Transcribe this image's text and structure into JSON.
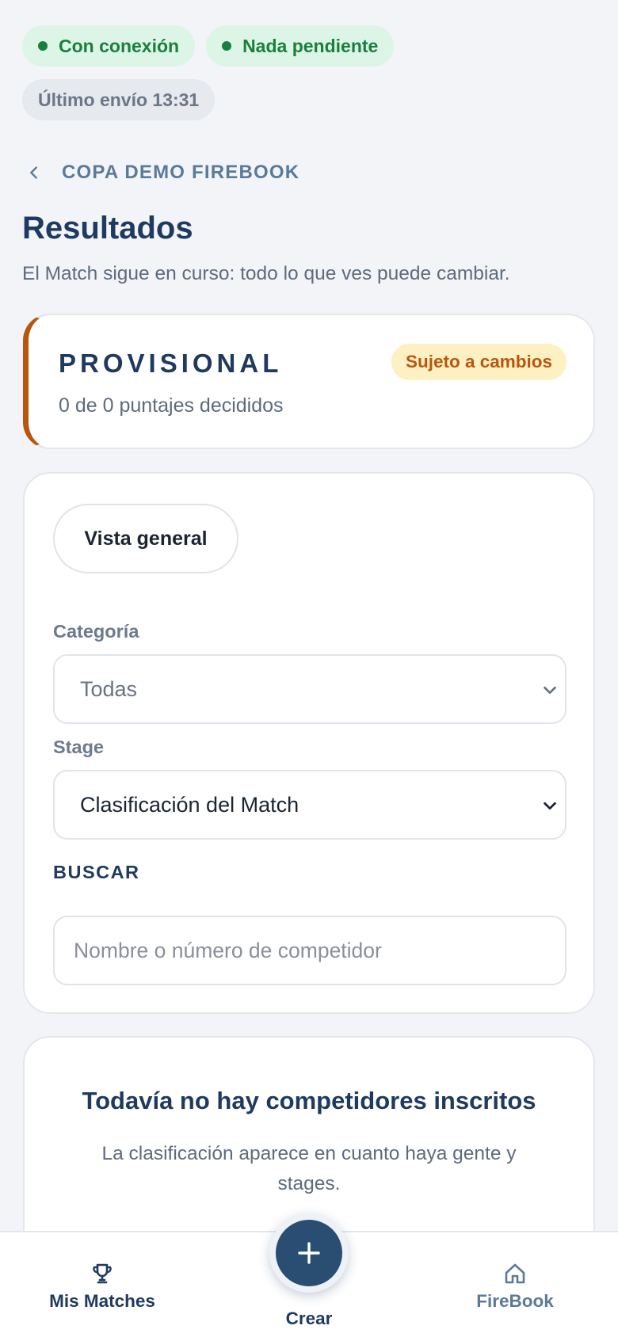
{
  "status": {
    "connection": "Con conexión",
    "pending": "Nada pendiente",
    "last_sent": "Último envío 13:31"
  },
  "breadcrumb": {
    "label": "COPA DEMO FIREBOOK"
  },
  "page": {
    "title": "Resultados",
    "subtitle": "El Match sigue en curso: todo lo que ves puede cambiar."
  },
  "provisional": {
    "title": "PROVISIONAL",
    "badge": "Sujeto a cambios",
    "count": "0 de 0 puntajes decididos"
  },
  "filters": {
    "view_button": "Vista general",
    "category_label": "Categoría",
    "category_value": "Todas",
    "stage_label": "Stage",
    "stage_value": "Clasificación del Match",
    "search_label": "BUSCAR",
    "search_placeholder": "Nombre o número de competidor"
  },
  "empty": {
    "title": "Todavía no hay competidores inscritos",
    "text": "La clasificación aparece en cuanto haya gente y stages."
  },
  "nav": {
    "matches": "Mis Matches",
    "create": "Crear",
    "home": "FireBook"
  },
  "colors": {
    "accent": "#1e3a5f",
    "status_green": "#1a7f3c",
    "warning": "#b8560f",
    "fab": "#2a4e72"
  }
}
